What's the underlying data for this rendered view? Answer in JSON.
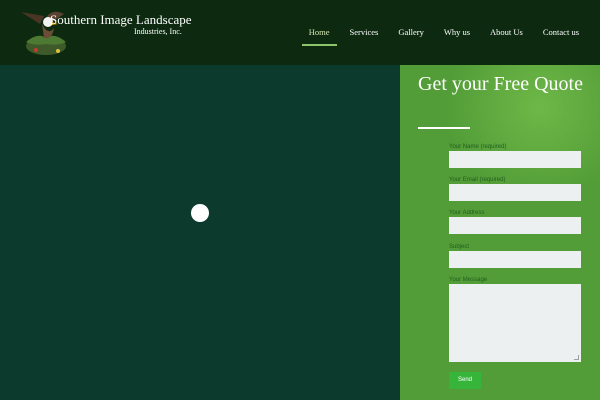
{
  "header": {
    "brand_line1": "Southern Image Landscape",
    "brand_line2": "Industries, Inc.",
    "logo_icon": "eagle-logo-icon"
  },
  "nav": {
    "items": [
      {
        "label": "Home",
        "active": true
      },
      {
        "label": "Services",
        "active": false
      },
      {
        "label": "Gallery",
        "active": false
      },
      {
        "label": "Why us",
        "active": false
      },
      {
        "label": "About Us",
        "active": false
      },
      {
        "label": "Contact us",
        "active": false
      }
    ]
  },
  "hero": {
    "loader_icon": "loading-spinner-icon"
  },
  "quote_form": {
    "title": "Get your Free Quote",
    "name_label": "Your Name (required)",
    "name_value": "",
    "email_label": "Your Email (required)",
    "email_value": "",
    "address_label": "Your Address",
    "address_value": "",
    "subject_label": "Subject",
    "subject_value": "",
    "message_label": "Your Message",
    "message_value": "",
    "send_label": "Send"
  },
  "colors": {
    "header_bg": "#0d2a11",
    "hero_bg": "#0c3a2d",
    "panel_bg": "#539d38",
    "send_button": "#37b53a",
    "active_underline": "#8ec46a"
  }
}
